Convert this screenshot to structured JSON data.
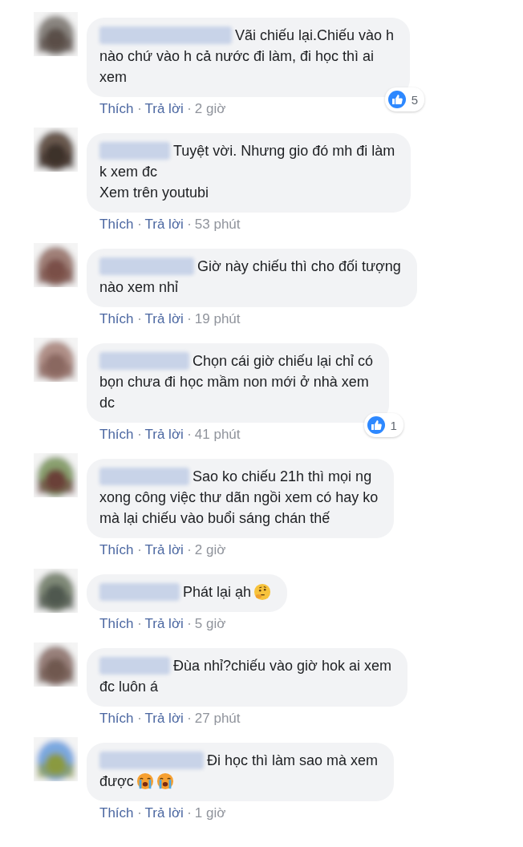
{
  "comments": [
    {
      "lines": [
        "Vãi chiếu lại.Chiếu vào h",
        "nào chứ vào h cả nước đi làm, đi học thì ai",
        "xem"
      ],
      "like": "Thích",
      "reply": "Trả lời",
      "time": "2 giờ",
      "reactions": "5"
    },
    {
      "lines": [
        "Tuyệt vời. Nhưng gio đó mh đi làm",
        "k xem đc",
        "Xem trên youtubi"
      ],
      "like": "Thích",
      "reply": "Trả lời",
      "time": "53 phút"
    },
    {
      "lines": [
        "Giờ này chiếu thì cho đối tượng",
        "nào xem nhỉ"
      ],
      "like": "Thích",
      "reply": "Trả lời",
      "time": "19 phút"
    },
    {
      "lines": [
        "Chọn cái giờ chiếu lại chỉ có",
        "bọn chưa đi học mầm non mới ở nhà xem",
        "dc"
      ],
      "like": "Thích",
      "reply": "Trả lời",
      "time": "41 phút",
      "reactions": "1"
    },
    {
      "lines": [
        "Sao ko chiếu 21h thì mọi ng",
        "xong công việc thư dãn ngồi xem có hay ko",
        "mà lại chiếu vào buổi sáng chán thế"
      ],
      "like": "Thích",
      "reply": "Trả lời",
      "time": "2 giờ"
    },
    {
      "lines": [
        "Phát lại ạh"
      ],
      "emoji": [
        {
          "kind": "thinking"
        }
      ],
      "like": "Thích",
      "reply": "Trả lời",
      "time": "5 giờ"
    },
    {
      "lines": [
        "Đùa nhỉ?chiếu vào giờ hok ai xem",
        "đc luôn á"
      ],
      "like": "Thích",
      "reply": "Trả lời",
      "time": "27 phút"
    },
    {
      "lines": [
        "Đi học thì làm sao mà xem",
        "được"
      ],
      "emoji": [
        {
          "kind": "crying"
        },
        {
          "kind": "crying"
        }
      ],
      "like": "Thích",
      "reply": "Trả lời",
      "time": "1 giờ"
    }
  ]
}
